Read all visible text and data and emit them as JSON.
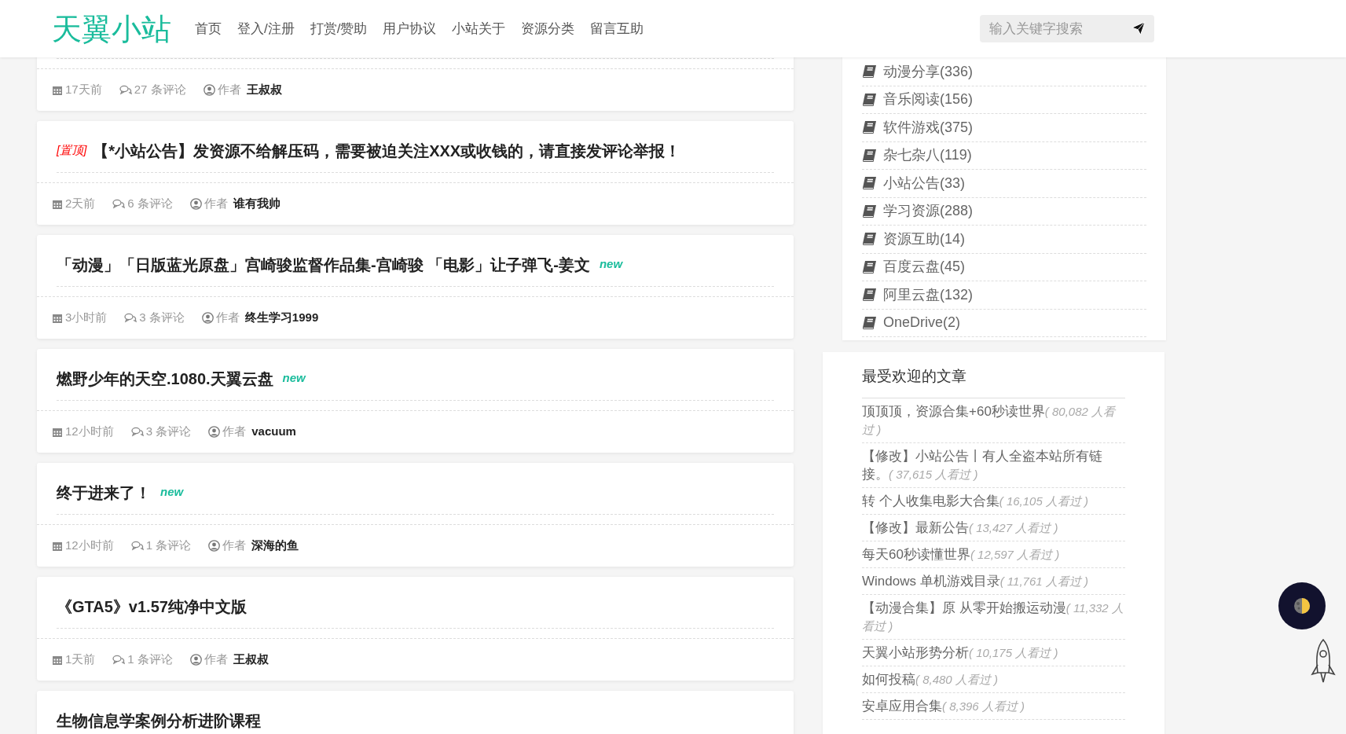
{
  "header": {
    "logo": "天翼小站",
    "nav": [
      {
        "label": "首页"
      },
      {
        "label": "登入/注册"
      },
      {
        "label": "打赏/赞助"
      },
      {
        "label": "用户协议"
      },
      {
        "label": "小站关于"
      },
      {
        "label": "资源分类"
      },
      {
        "label": "留言互助"
      }
    ],
    "search": {
      "placeholder": "输入关键字搜索"
    }
  },
  "posts": [
    {
      "time": "17天前",
      "comments": "27 条评论",
      "author_label": "作者",
      "author": "王叔叔"
    },
    {
      "pinned_tag": "[置顶]",
      "title": "【*小站公告】发资源不给解压码，需要被迫关注XXX或收钱的，请直接发评论举报！",
      "time": "2天前",
      "comments": "6 条评论",
      "author_label": "作者",
      "author": "谁有我帅"
    },
    {
      "title": "「动漫」「日版蓝光原盘」宫崎骏监督作品集-宫崎骏 「电影」让子弹飞-姜文",
      "new_tag": "new",
      "time": "3小时前",
      "comments": "3 条评论",
      "author_label": "作者",
      "author": "终生学习1999"
    },
    {
      "title": "燃野少年的天空.1080.天翼云盘",
      "new_tag": "new",
      "time": "12小时前",
      "comments": "3 条评论",
      "author_label": "作者",
      "author": "vacuum"
    },
    {
      "title": "终于进来了！",
      "new_tag": "new",
      "time": "12小时前",
      "comments": "1 条评论",
      "author_label": "作者",
      "author": "深海的鱼"
    },
    {
      "title": "《GTA5》v1.57纯净中文版",
      "time": "1天前",
      "comments": "1 条评论",
      "author_label": "作者",
      "author": "王叔叔"
    },
    {
      "title": "生物信息学案例分析进阶课程"
    }
  ],
  "categories": [
    {
      "label": "动漫分享(336)"
    },
    {
      "label": "音乐阅读(156)"
    },
    {
      "label": "软件游戏(375)"
    },
    {
      "label": "杂七杂八(119)"
    },
    {
      "label": "小站公告(33)"
    },
    {
      "label": "学习资源(288)"
    },
    {
      "label": "资源互助(14)"
    },
    {
      "label": "百度云盘(45)"
    },
    {
      "label": "阿里云盘(132)"
    },
    {
      "label": "OneDrive(2)"
    }
  ],
  "popular": {
    "title": "最受欢迎的文章",
    "items": [
      {
        "title": "顶顶顶，资源合集+60秒读世界",
        "views": "( 80,082 人看过 )"
      },
      {
        "title": "【修改】小站公告丨有人全盗本站所有链接。",
        "views": "( 37,615 人看过 )"
      },
      {
        "title": "转 个人收集电影大合集",
        "views": "( 16,105 人看过 )"
      },
      {
        "title": "【修改】最新公告",
        "views": "( 13,427 人看过 )"
      },
      {
        "title": "每天60秒读懂世界",
        "views": "( 12,597 人看过 )"
      },
      {
        "title": "Windows 单机游戏目录",
        "views": "( 11,761 人看过 )"
      },
      {
        "title": "【动漫合集】原 从零开始搬运动漫",
        "views": "( 11,332 人看过 )"
      },
      {
        "title": "天翼小站形势分析",
        "views": "( 10,175 人看过 )"
      },
      {
        "title": "如何投稿",
        "views": "( 8,480 人看过 )"
      },
      {
        "title": "安卓应用合集",
        "views": "( 8,396 人看过 )"
      }
    ]
  }
}
